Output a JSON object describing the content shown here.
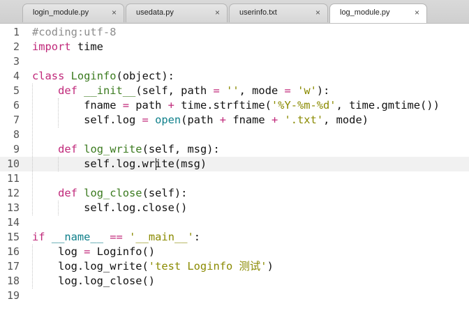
{
  "tabs": [
    {
      "label": "login_module.py",
      "active": false
    },
    {
      "label": "usedata.py",
      "active": false
    },
    {
      "label": "userinfo.txt",
      "active": false
    },
    {
      "label": "log_module.py",
      "active": true
    }
  ],
  "close_glyph": "×",
  "editor": {
    "current_line": 10,
    "lines": [
      {
        "n": "1",
        "text": "#coding:utf-8"
      },
      {
        "n": "2",
        "text": "import time"
      },
      {
        "n": "3",
        "text": ""
      },
      {
        "n": "4",
        "text": "class Loginfo(object):"
      },
      {
        "n": "5",
        "text": "    def __init__(self, path = '', mode = 'w'):"
      },
      {
        "n": "6",
        "text": "        fname = path + time.strftime('%Y-%m-%d', time.gmtime())"
      },
      {
        "n": "7",
        "text": "        self.log = open(path + fname + '.txt', mode)"
      },
      {
        "n": "8",
        "text": ""
      },
      {
        "n": "9",
        "text": "    def log_write(self, msg):"
      },
      {
        "n": "10",
        "text": "        self.log.write(msg)"
      },
      {
        "n": "11",
        "text": ""
      },
      {
        "n": "12",
        "text": "    def log_close(self):"
      },
      {
        "n": "13",
        "text": "        self.log.close()"
      },
      {
        "n": "14",
        "text": ""
      },
      {
        "n": "15",
        "text": "if __name__ == '__main__':"
      },
      {
        "n": "16",
        "text": "    log = Loginfo()"
      },
      {
        "n": "17",
        "text": "    log.log_write('test Loginfo 测试')"
      },
      {
        "n": "18",
        "text": "    log.log_close()"
      },
      {
        "n": "19",
        "text": ""
      }
    ]
  },
  "colors": {
    "keyword": "#c0287a",
    "function": "#3a7a1e",
    "string": "#8a8a00",
    "comment": "#8d8d8d",
    "current_line_bg": "#f1f1f1"
  }
}
